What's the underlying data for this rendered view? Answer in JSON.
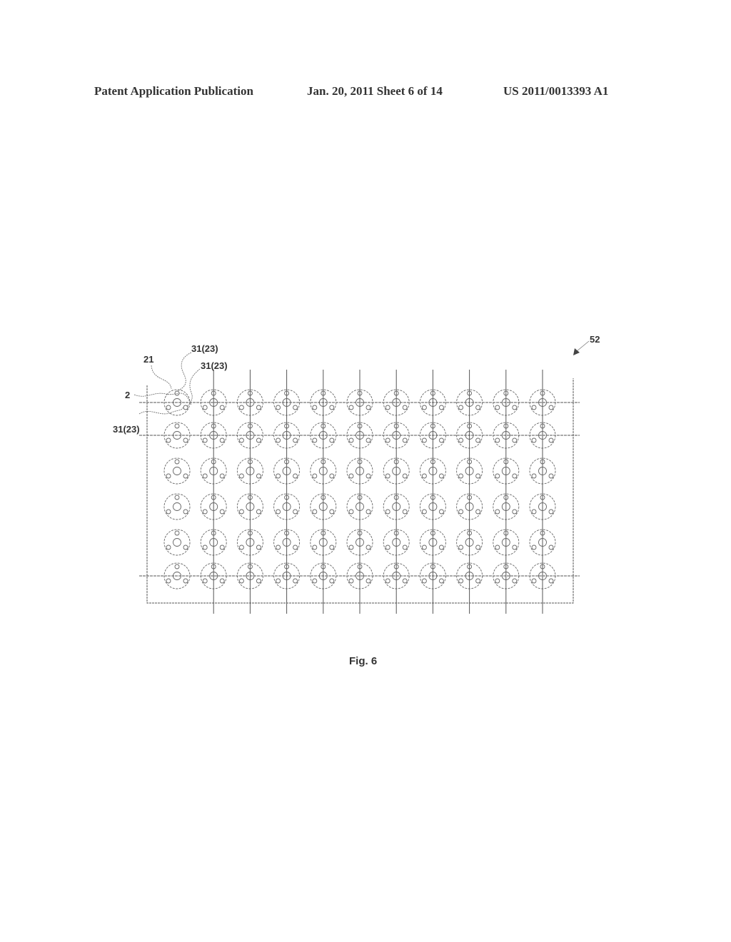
{
  "header": {
    "publication": "Patent Application Publication",
    "date_sheet": "Jan. 20, 2011   Sheet 6 of 14",
    "number": "US 2011/0013393 A1"
  },
  "figure": {
    "caption": "Fig. 6",
    "reference": "52",
    "grid": {
      "rows": 6,
      "columns": 11
    },
    "labels": {
      "l21": "21",
      "l2": "2",
      "l31a": "31(23)",
      "l31b": "31(23)",
      "l31c": "31(23)"
    }
  }
}
